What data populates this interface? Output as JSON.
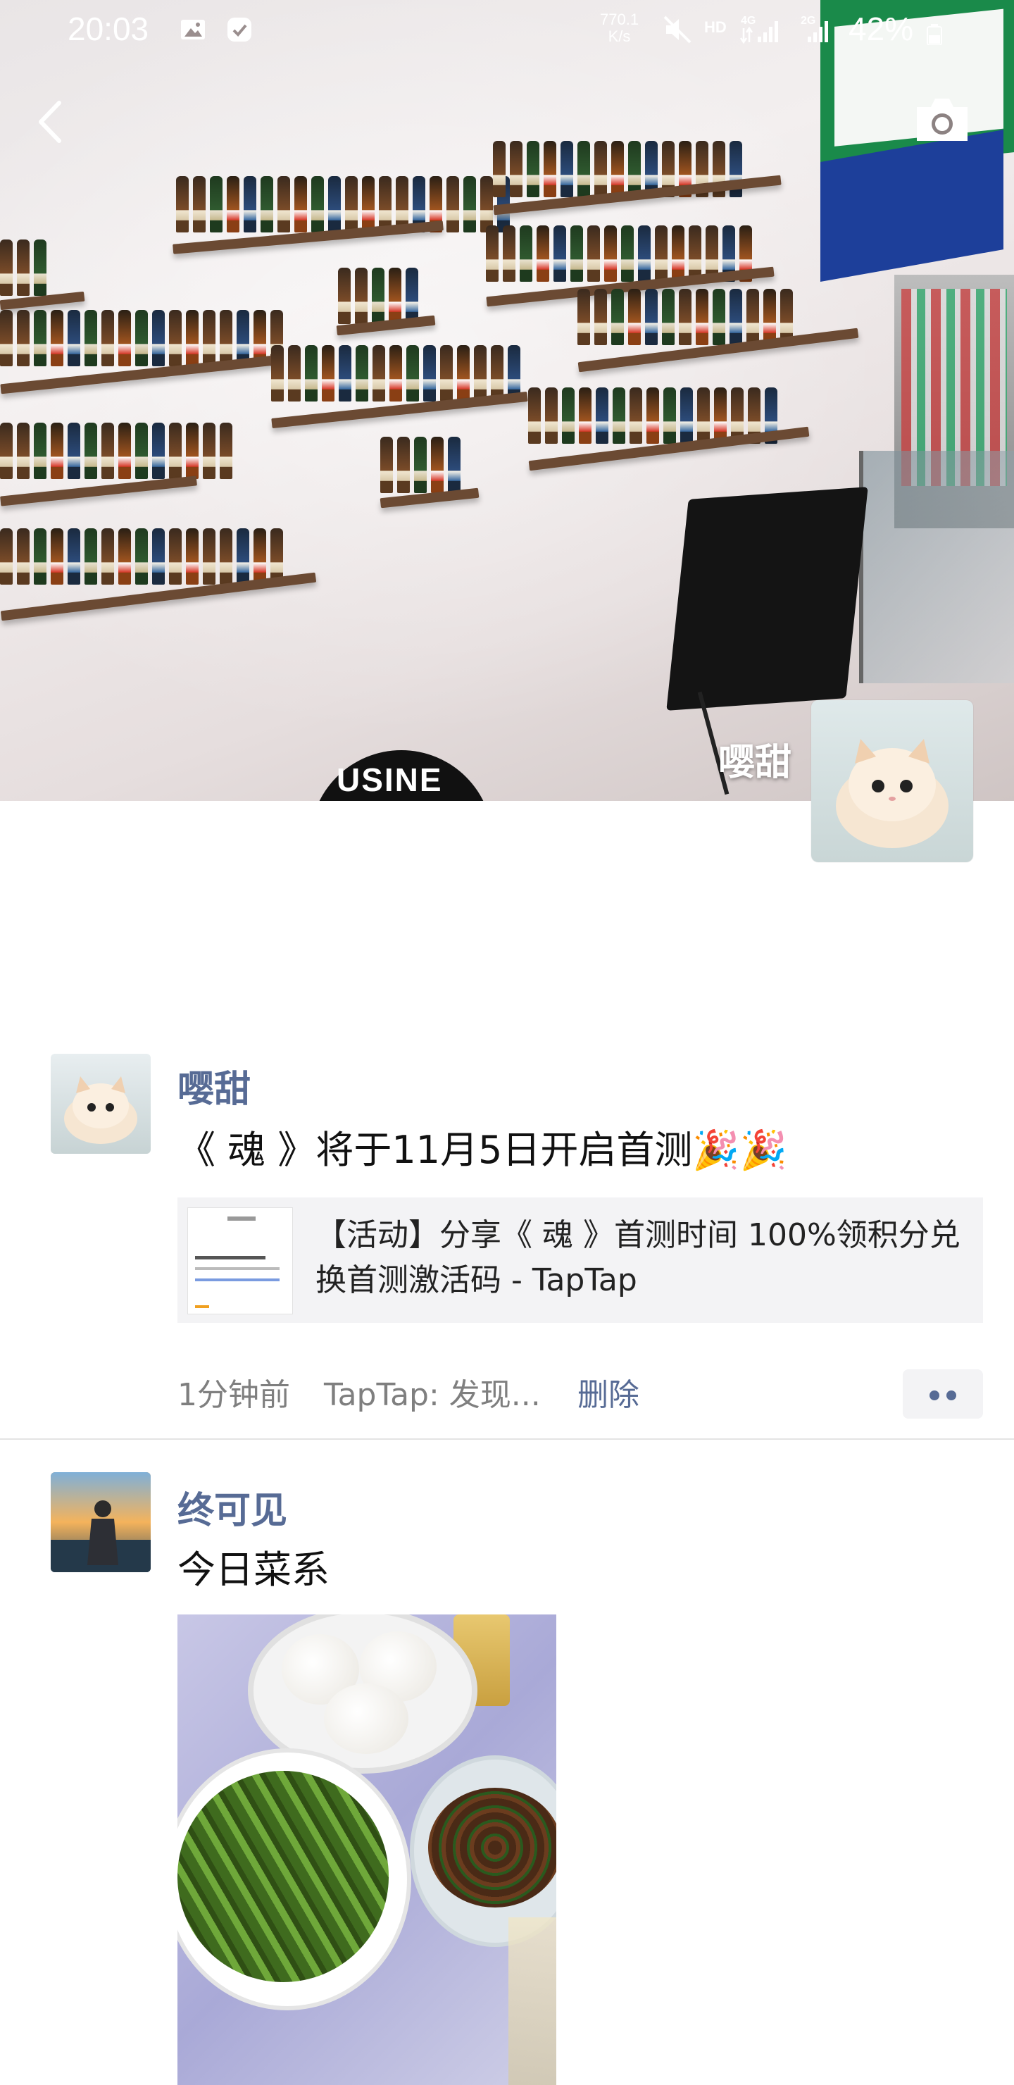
{
  "status_bar": {
    "time": "20:03",
    "speed_value": "770.1",
    "speed_unit": "K/s",
    "hd": "HD",
    "net_4g": "4G",
    "net_2g": "2G",
    "battery": "42%"
  },
  "cover": {
    "owner_name": "嘤甜",
    "chair_text": "USINE",
    "back_icon": "chevron-left-icon",
    "camera_icon": "camera-icon"
  },
  "posts": [
    {
      "name": "嘤甜",
      "text": "《 魂 》将于11月5日开启首测🎉🎉",
      "link_title": "【活动】分享《 魂 》首测时间 100%领积分兑换首测激活码 - TapTap",
      "time": "1分钟前",
      "source": "TapTap: 发现...",
      "delete_label": "删除"
    },
    {
      "name": "终可见",
      "text": "今日菜系"
    }
  ],
  "colors": {
    "name_blue": "#576b95",
    "divider": "#e4e4e4",
    "card_bg": "#f3f3f5"
  }
}
